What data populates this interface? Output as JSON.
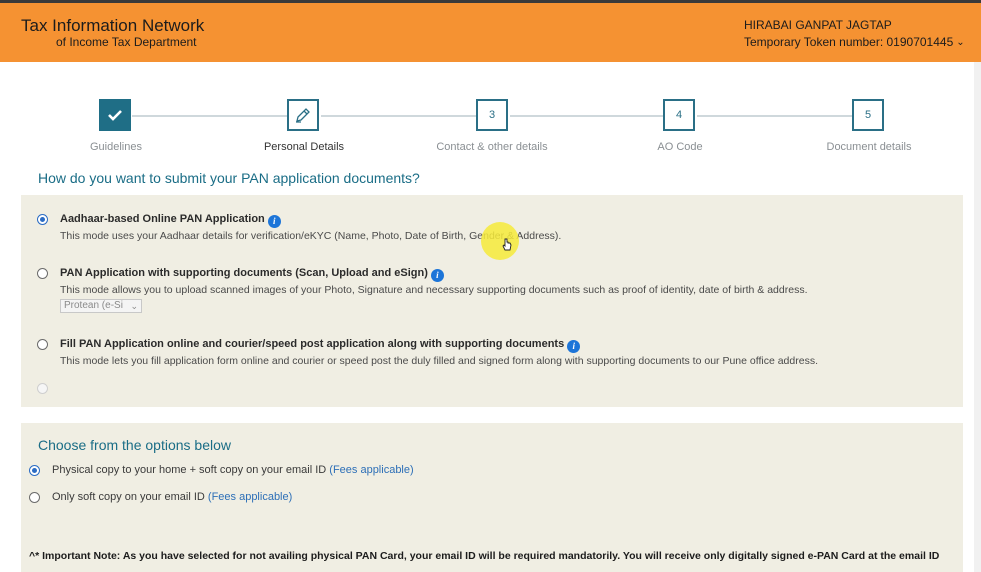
{
  "header": {
    "brand_line1": "Tax Information Network",
    "brand_line2": "of Income Tax Department",
    "user_name": "HIRABAI GANPAT JAGTAP",
    "token": "Temporary Token number: 0190701445"
  },
  "steps": [
    {
      "label": "Guidelines",
      "state": "done",
      "icon": "checkmark-icon"
    },
    {
      "label": "Personal Details",
      "state": "active",
      "icon": "pencil-icon"
    },
    {
      "label": "Contact & other details",
      "number": "3",
      "state": "pending"
    },
    {
      "label": "AO Code",
      "number": "4",
      "state": "pending"
    },
    {
      "label": "Document details",
      "number": "5",
      "state": "pending"
    }
  ],
  "submission": {
    "question": "How do you want to submit your PAN application documents?",
    "options": [
      {
        "title": "Aadhaar-based Online PAN Application",
        "description": "This mode uses your Aadhaar details for verification/eKYC (Name, Photo, Date of Birth, Gender & Address).",
        "selected": true
      },
      {
        "title": "PAN Application with supporting documents (Scan, Upload and eSign)",
        "description": "This mode allows you to upload scanned images of your Photo, Signature and necessary supporting documents such as proof of identity, date of birth & address.",
        "selected": false,
        "dropdown_value": "Protean (e-Si"
      },
      {
        "title": "Fill PAN Application online and courier/speed post application along with supporting documents",
        "description": "This mode lets you fill application form online and courier or speed post the duly filled and signed form along with supporting documents to our Pune office address.",
        "selected": false
      }
    ]
  },
  "delivery": {
    "title": "Choose from the options below",
    "options": [
      {
        "text": "Physical copy to your home + soft copy on your email ID",
        "fees": "(Fees applicable)",
        "selected": true
      },
      {
        "text": "Only soft copy on your email ID",
        "fees": "(Fees applicable)",
        "selected": false
      }
    ],
    "note": "^* Important Note: As you have selected for not availing physical PAN Card, your email ID will be required mandatorily. You will receive only digitally signed e-PAN Card at the email ID"
  },
  "colors": {
    "header_bg": "#f59232",
    "accent_teal": "#1a6d86",
    "panel_bg": "#f0eee3",
    "link_blue": "#2d6fb7"
  }
}
